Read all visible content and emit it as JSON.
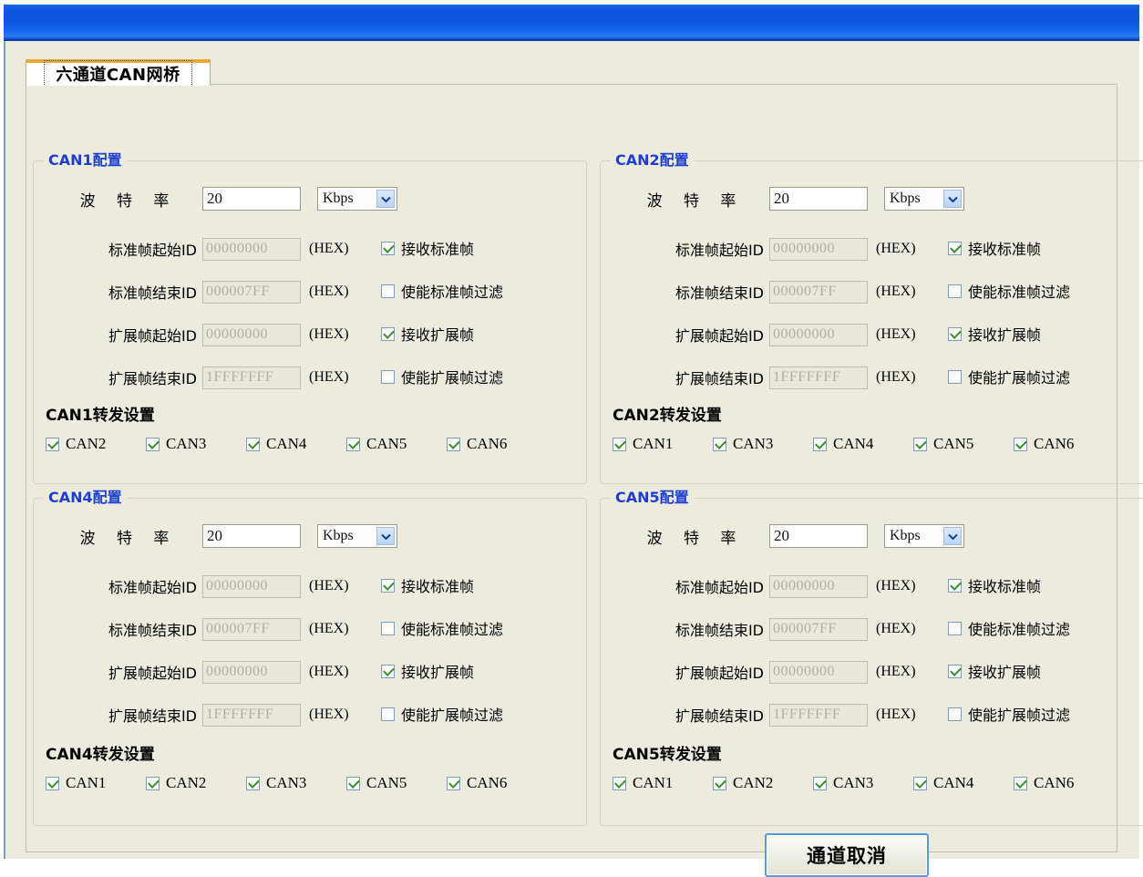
{
  "window": {
    "titlebar_text": ""
  },
  "tabs": [
    {
      "label": "六通道CAN网桥",
      "selected": true
    }
  ],
  "labels": {
    "baud_rate": "波 特 率",
    "std_start_id": "标准帧起始ID",
    "std_end_id": "标准帧结束ID",
    "ext_start_id": "扩展帧起始ID",
    "ext_end_id": "扩展帧结束ID",
    "hex": "(HEX)",
    "recv_std_frame": "接收标准帧",
    "enable_std_filter": "使能标准帧过滤",
    "recv_ext_frame": "接收扩展帧",
    "enable_ext_filter": "使能扩展帧过滤"
  },
  "panels": [
    {
      "key": "can1",
      "title_prefix": "CAN1",
      "title_suffix": "配置",
      "baud_value": "20",
      "baud_unit": "Kbps",
      "std_start_id": "00000000",
      "std_end_id": "000007FF",
      "ext_start_id": "00000000",
      "ext_end_id": "1FFFFFFF",
      "recv_std_frame": true,
      "enable_std_filter": false,
      "recv_ext_frame": true,
      "enable_ext_filter": false,
      "forward_title": "CAN1转发设置",
      "forward_targets": [
        {
          "label": "CAN2",
          "checked": true
        },
        {
          "label": "CAN3",
          "checked": true
        },
        {
          "label": "CAN4",
          "checked": true
        },
        {
          "label": "CAN5",
          "checked": true
        },
        {
          "label": "CAN6",
          "checked": true
        }
      ]
    },
    {
      "key": "can2",
      "title_prefix": "CAN2",
      "title_suffix": "配置",
      "baud_value": "20",
      "baud_unit": "Kbps",
      "std_start_id": "00000000",
      "std_end_id": "000007FF",
      "ext_start_id": "00000000",
      "ext_end_id": "1FFFFFFF",
      "recv_std_frame": true,
      "enable_std_filter": false,
      "recv_ext_frame": true,
      "enable_ext_filter": false,
      "forward_title": "CAN2转发设置",
      "forward_targets": [
        {
          "label": "CAN1",
          "checked": true
        },
        {
          "label": "CAN3",
          "checked": true
        },
        {
          "label": "CAN4",
          "checked": true
        },
        {
          "label": "CAN5",
          "checked": true
        },
        {
          "label": "CAN6",
          "checked": true
        }
      ]
    },
    {
      "key": "can4",
      "title_prefix": "CAN4",
      "title_suffix": "配置",
      "baud_value": "20",
      "baud_unit": "Kbps",
      "std_start_id": "00000000",
      "std_end_id": "000007FF",
      "ext_start_id": "00000000",
      "ext_end_id": "1FFFFFFF",
      "recv_std_frame": true,
      "enable_std_filter": false,
      "recv_ext_frame": true,
      "enable_ext_filter": false,
      "forward_title": "CAN4转发设置",
      "forward_targets": [
        {
          "label": "CAN1",
          "checked": true
        },
        {
          "label": "CAN2",
          "checked": true
        },
        {
          "label": "CAN3",
          "checked": true
        },
        {
          "label": "CAN5",
          "checked": true
        },
        {
          "label": "CAN6",
          "checked": true
        }
      ]
    },
    {
      "key": "can5",
      "title_prefix": "CAN5",
      "title_suffix": "配置",
      "baud_value": "20",
      "baud_unit": "Kbps",
      "std_start_id": "00000000",
      "std_end_id": "000007FF",
      "ext_start_id": "00000000",
      "ext_end_id": "1FFFFFFF",
      "recv_std_frame": true,
      "enable_std_filter": false,
      "recv_ext_frame": true,
      "enable_ext_filter": false,
      "forward_title": "CAN5转发设置",
      "forward_targets": [
        {
          "label": "CAN1",
          "checked": true
        },
        {
          "label": "CAN2",
          "checked": true
        },
        {
          "label": "CAN3",
          "checked": true
        },
        {
          "label": "CAN4",
          "checked": true
        },
        {
          "label": "CAN6",
          "checked": true
        }
      ]
    }
  ],
  "footer": {
    "cancel_button": "通道取消"
  },
  "colors": {
    "titlebar_blue": "#0d58e0",
    "group_title_blue": "#1d3fd0",
    "panel_bg": "#ecebdd",
    "tab_accent": "#e8a933",
    "check_green": "#3a8f2f",
    "button_border_blue": "#5b9bd5"
  }
}
